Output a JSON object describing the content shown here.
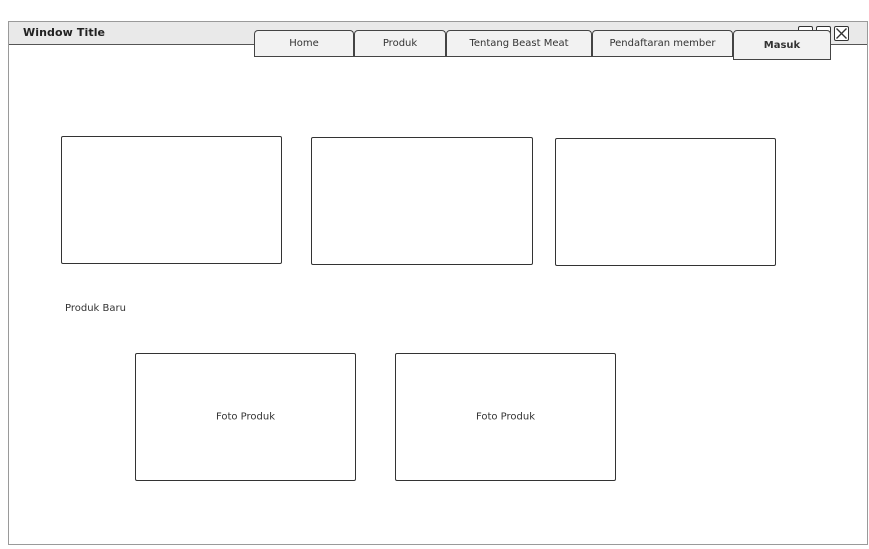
{
  "window": {
    "title": "Window Title"
  },
  "nav": {
    "tabs": [
      {
        "label": "Home"
      },
      {
        "label": "Produk"
      },
      {
        "label": "Tentang Beast Meat"
      },
      {
        "label": "Pendaftaran member"
      },
      {
        "label": "Masuk",
        "active": true
      }
    ]
  },
  "new_products": {
    "label": "Produk Baru",
    "cards": [
      {
        "label": "Foto Produk"
      },
      {
        "label": "Foto Produk"
      }
    ]
  }
}
